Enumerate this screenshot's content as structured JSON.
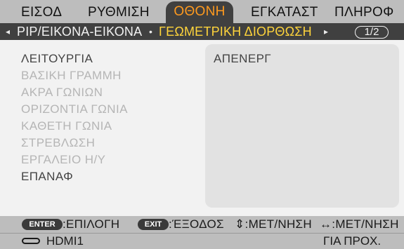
{
  "tabs": [
    {
      "label": "ΕΙΣΟΔ",
      "active": false
    },
    {
      "label": "ΡΥΘΜΙΣΗ",
      "active": false
    },
    {
      "label": "ΟΘΟΝΗ",
      "active": true
    },
    {
      "label": "ΕΓΚΑΤΑΣΤ",
      "active": false
    },
    {
      "label": "ΠΛΗΡΟΦ",
      "active": false
    }
  ],
  "subtabs": {
    "left_arrow": "◂",
    "items": [
      {
        "label": "PIP/ΕΙΚΟΝΑ-ΕΙΚΟΝΑ",
        "active": false
      },
      {
        "label": "ΓΕΩΜΕΤΡΙΚΗ ΔΙΟΡΘΩΣΗ",
        "active": true
      }
    ],
    "separator": "•",
    "right_arrow": "▸",
    "page": "1/2"
  },
  "menu": {
    "items": [
      {
        "label": "ΛΕΙΤΟΥΡΓΙΑ",
        "enabled": true
      },
      {
        "label": "ΒΑΣΙΚΗ ΓΡΑΜΜΗ",
        "enabled": false
      },
      {
        "label": "ΑΚΡΑ ΓΩΝΙΩΝ",
        "enabled": false
      },
      {
        "label": "ΟΡΙΖΟΝΤΙΑ ΓΩΝΙΑ",
        "enabled": false
      },
      {
        "label": "ΚΑΘΕΤΗ ΓΩΝΙΑ",
        "enabled": false
      },
      {
        "label": "ΣΤΡΕΒΛΩΣΗ",
        "enabled": false
      },
      {
        "label": "ΕΡΓΑΛΕΙΟ Η/Υ",
        "enabled": false
      },
      {
        "label": "ΕΠΑΝΑΦ",
        "enabled": true
      }
    ],
    "value": "ΑΠΕΝΕΡΓ"
  },
  "footer": {
    "enter_key": "ENTER",
    "enter_text": ":ΕΠΙΛΟΓΗ",
    "exit_key": "EXIT",
    "exit_text": ":ΈΞΟΔΟΣ",
    "move_vertical": "⇕:ΜΕΤ/ΝΗΣΗ",
    "move_horizontal": "↔:ΜΕΤ/ΝΗΣΗ",
    "source": "HDMI1",
    "mode": "ΓΙΑ ΠΡΟΧ."
  },
  "colors": {
    "active_tab_text": "#ff9a1e",
    "active_subtab_text": "#ffd43b",
    "dark_bar": "#404040",
    "tab_bar": "#bdbdbd",
    "panel": "#f2f2f2",
    "value_box": "#e2e2e2"
  }
}
